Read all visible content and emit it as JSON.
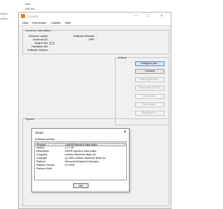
{
  "background": {
    "header_size": "Size",
    "header_kb": "596 KB",
    "left_fragments": [
      "ication",
      "ication"
    ]
  },
  "window": {
    "title": "Classify",
    "controls": {
      "minimize": "—",
      "maximize": "☐",
      "close": "✕"
    },
    "menu": [
      "Data",
      "Connection",
      "Classes",
      "Help"
    ]
  },
  "governor": {
    "legend": "Governor information",
    "model_label": "Governor model:",
    "model_value": "-",
    "id_label": "Governor ID:",
    "id_value": "-",
    "engine_label": "Engine SN:",
    "hardware_label": "Hardware SN:",
    "hardware_value": "-",
    "software_version_label": "Software Version:",
    "software_version_value": "-",
    "software_release_label": "Software Release:",
    "software_release_value": "-",
    "spp_label": "SPP:",
    "spp_value": "-"
  },
  "actions": {
    "legend": "Actions",
    "buttons": [
      {
        "label": "Configure port...",
        "enabled": true
      },
      {
        "label": "Connect",
        "enabled": true
      },
      {
        "label": "Edit Engine SN...",
        "enabled": false
      },
      {
        "label": "Send data to ECU",
        "enabled": false
      },
      {
        "label": "Load data...",
        "enabled": false
      },
      {
        "label": "Save data...",
        "enabled": false
      },
      {
        "label": "Running Lin...",
        "enabled": false
      }
    ]
  },
  "figures": {
    "legend": "Figures"
  },
  "about": {
    "title": "About",
    "close": "✕",
    "subtitle": "Software version:",
    "rows": [
      {
        "key": "Product",
        "value": "UH/DR injector's class editor"
      },
      {
        "key": "Version",
        "value": "1.2.1.44"
      },
      {
        "key": "Description",
        "value": "UH/DR injector's class editor"
      },
      {
        "key": "Company",
        "value": "Liebherr Machines Bulle SA"
      },
      {
        "key": "Copyright",
        "value": "(c) 2004 Liebherr Machines Bulle SA"
      },
      {
        "key": "Platform",
        "value": "Microsoft Windows (Unknown)"
      },
      {
        "key": "Platform Version",
        "value": "6.2.9200"
      },
      {
        "key": "Platform Build",
        "value": ""
      }
    ],
    "ok_label": "OK"
  }
}
